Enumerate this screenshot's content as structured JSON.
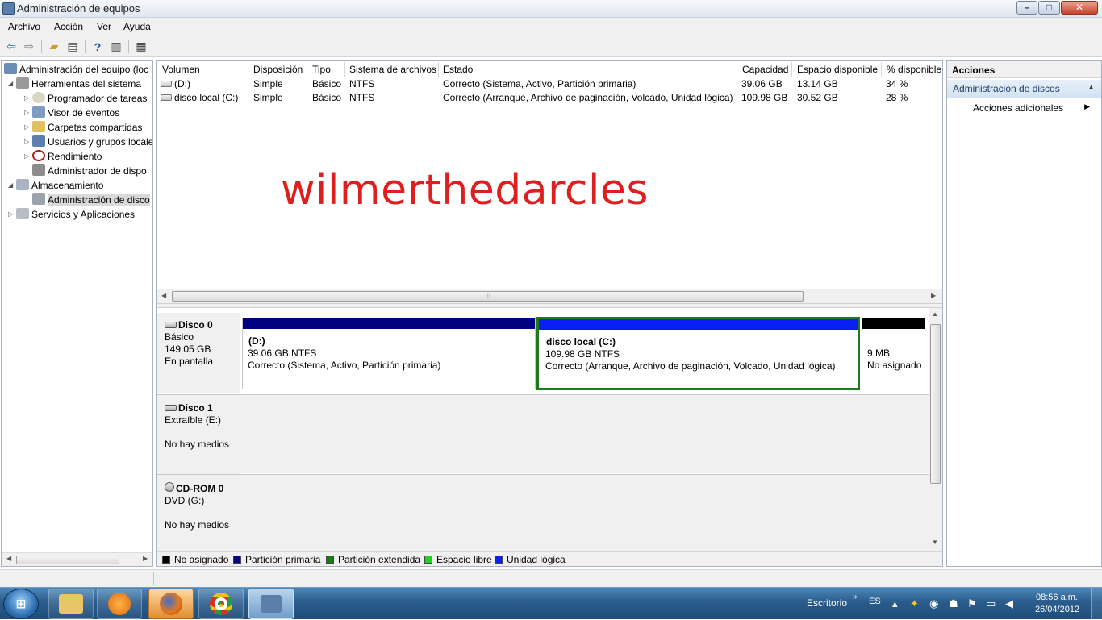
{
  "window": {
    "title": "Administración de equipos",
    "controls": {
      "minimize": "–",
      "maximize": "□",
      "close": "✕"
    }
  },
  "menu": [
    "Archivo",
    "Acción",
    "Ver",
    "Ayuda"
  ],
  "toolbar": {
    "icons": [
      "back-icon",
      "forward-icon",
      "up-folder-icon",
      "show-hide-tree-icon",
      "help-icon",
      "show-hide-action-pane-icon",
      "properties-icon"
    ]
  },
  "tree": {
    "root": "Administración del equipo (loc",
    "items": [
      {
        "label": "Herramientas del sistema",
        "icon": "tools-icon"
      },
      {
        "label": "Programador de tareas",
        "icon": "clock-icon"
      },
      {
        "label": "Visor de eventos",
        "icon": "event-viewer-icon"
      },
      {
        "label": "Carpetas compartidas",
        "icon": "shared-folder-icon"
      },
      {
        "label": "Usuarios y grupos locale",
        "icon": "users-icon"
      },
      {
        "label": "Rendimiento",
        "icon": "performance-icon"
      },
      {
        "label": "Administrador de dispo",
        "icon": "device-manager-icon"
      },
      {
        "label": "Almacenamiento",
        "icon": "storage-icon"
      },
      {
        "label": "Administración de disco",
        "icon": "disk-management-icon"
      },
      {
        "label": "Servicios y Aplicaciones",
        "icon": "services-icon"
      }
    ]
  },
  "volumes": {
    "columns": [
      "Volumen",
      "Disposición",
      "Tipo",
      "Sistema de archivos",
      "Estado",
      "Capacidad",
      "Espacio disponible",
      "% disponible"
    ],
    "rows": [
      [
        "(D:)",
        "Simple",
        "Básico",
        "NTFS",
        "Correcto (Sistema, Activo, Partición primaria)",
        "39.06 GB",
        "13.14 GB",
        "34 %"
      ],
      [
        "disco local (C:)",
        "Simple",
        "Básico",
        "NTFS",
        "Correcto (Arranque, Archivo de paginación, Volcado, Unidad lógica)",
        "109.98 GB",
        "30.52 GB",
        "28 %"
      ]
    ],
    "scroll_grip": "⦙⦙⦙"
  },
  "watermark": "wilmerthedarcles",
  "disks": [
    {
      "name": "Disco 0",
      "lines": [
        "Básico",
        "149.05 GB",
        "En pantalla"
      ],
      "partitions": [
        {
          "name": "(D:)",
          "size": "39.06 GB NTFS",
          "status": "Correcto (Sistema, Activo, Partición primaria)",
          "color": "#000080"
        },
        {
          "name": "disco local  (C:)",
          "size": "109.98 GB NTFS",
          "status": "Correcto (Arranque, Archivo de paginación, Volcado, Unidad lógica)",
          "color": "#0a1ff5"
        },
        {
          "name": "",
          "size": "9 MB",
          "status": "No asignado",
          "color": "#000000"
        }
      ]
    },
    {
      "name": "Disco 1",
      "lines": [
        "Extraíble (E:)",
        "",
        "No hay medios"
      ],
      "partitions": []
    },
    {
      "name": "CD-ROM 0",
      "lines": [
        "DVD (G:)",
        "",
        "No hay medios"
      ],
      "partitions": []
    }
  ],
  "legend": [
    {
      "label": "No asignado",
      "color": "#000000"
    },
    {
      "label": "Partición primaria",
      "color": "#000080"
    },
    {
      "label": "Partición extendida",
      "color": "#1a7a1a"
    },
    {
      "label": "Espacio libre",
      "color": "#22d022"
    },
    {
      "label": "Unidad lógica",
      "color": "#0a1ff5"
    }
  ],
  "actions": {
    "header": "Acciones",
    "section": "Administración de discos",
    "item": "Acciones adicionales"
  },
  "taskbar": {
    "start_icon": "windows-orb-icon",
    "apps": [
      "explorer-icon",
      "media-player-icon",
      "firefox-icon",
      "chrome-icon",
      "computer-management-icon"
    ],
    "toolbar_label": "Escritorio",
    "chevron": "»",
    "language": "ES",
    "time": "08:56 a.m.",
    "date": "26/04/2012"
  }
}
